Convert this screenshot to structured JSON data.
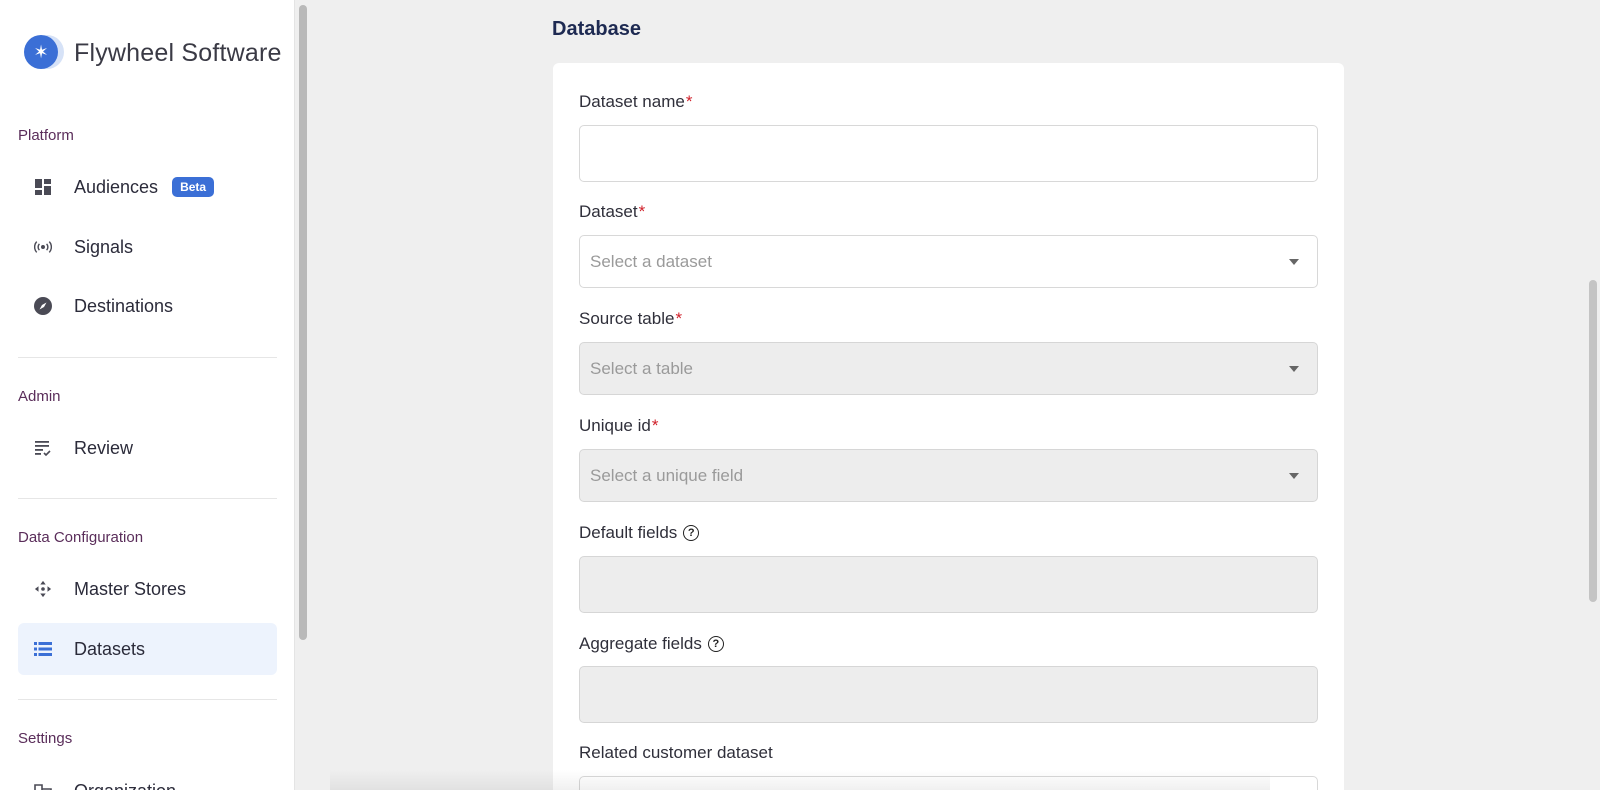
{
  "brand": {
    "name": "Flywheel Software",
    "logo_icon": "flywheel-logo-icon"
  },
  "sidebar": {
    "sections": [
      {
        "label": "Platform"
      },
      {
        "label": "Admin"
      },
      {
        "label": "Data Configuration"
      },
      {
        "label": "Settings"
      }
    ],
    "items": [
      {
        "label": "Audiences",
        "icon": "dashboard-icon",
        "badge": "Beta"
      },
      {
        "label": "Signals",
        "icon": "broadcast-icon"
      },
      {
        "label": "Destinations",
        "icon": "compass-icon"
      },
      {
        "label": "Review",
        "icon": "list-check-icon"
      },
      {
        "label": "Master Stores",
        "icon": "move-arrows-icon"
      },
      {
        "label": "Datasets",
        "icon": "dataset-list-icon",
        "active": true
      },
      {
        "label": "Organization",
        "icon": "organization-icon"
      }
    ]
  },
  "main": {
    "title": "Database",
    "fields": [
      {
        "label": "Dataset name",
        "required": "*",
        "value": ""
      },
      {
        "label": "Dataset",
        "required": "*",
        "placeholder": "Select a dataset"
      },
      {
        "label": "Source table",
        "required": "*",
        "placeholder": "Select a table"
      },
      {
        "label": "Unique id",
        "required": "*",
        "placeholder": "Select a unique field"
      },
      {
        "label": "Default fields",
        "help": "?"
      },
      {
        "label": "Aggregate fields",
        "help": "?"
      },
      {
        "label": "Related customer dataset"
      }
    ]
  },
  "colors": {
    "accent": "#3b6fd6",
    "required": "#d0202a",
    "section_label": "#5a2d5a",
    "title": "#1e2a52"
  }
}
